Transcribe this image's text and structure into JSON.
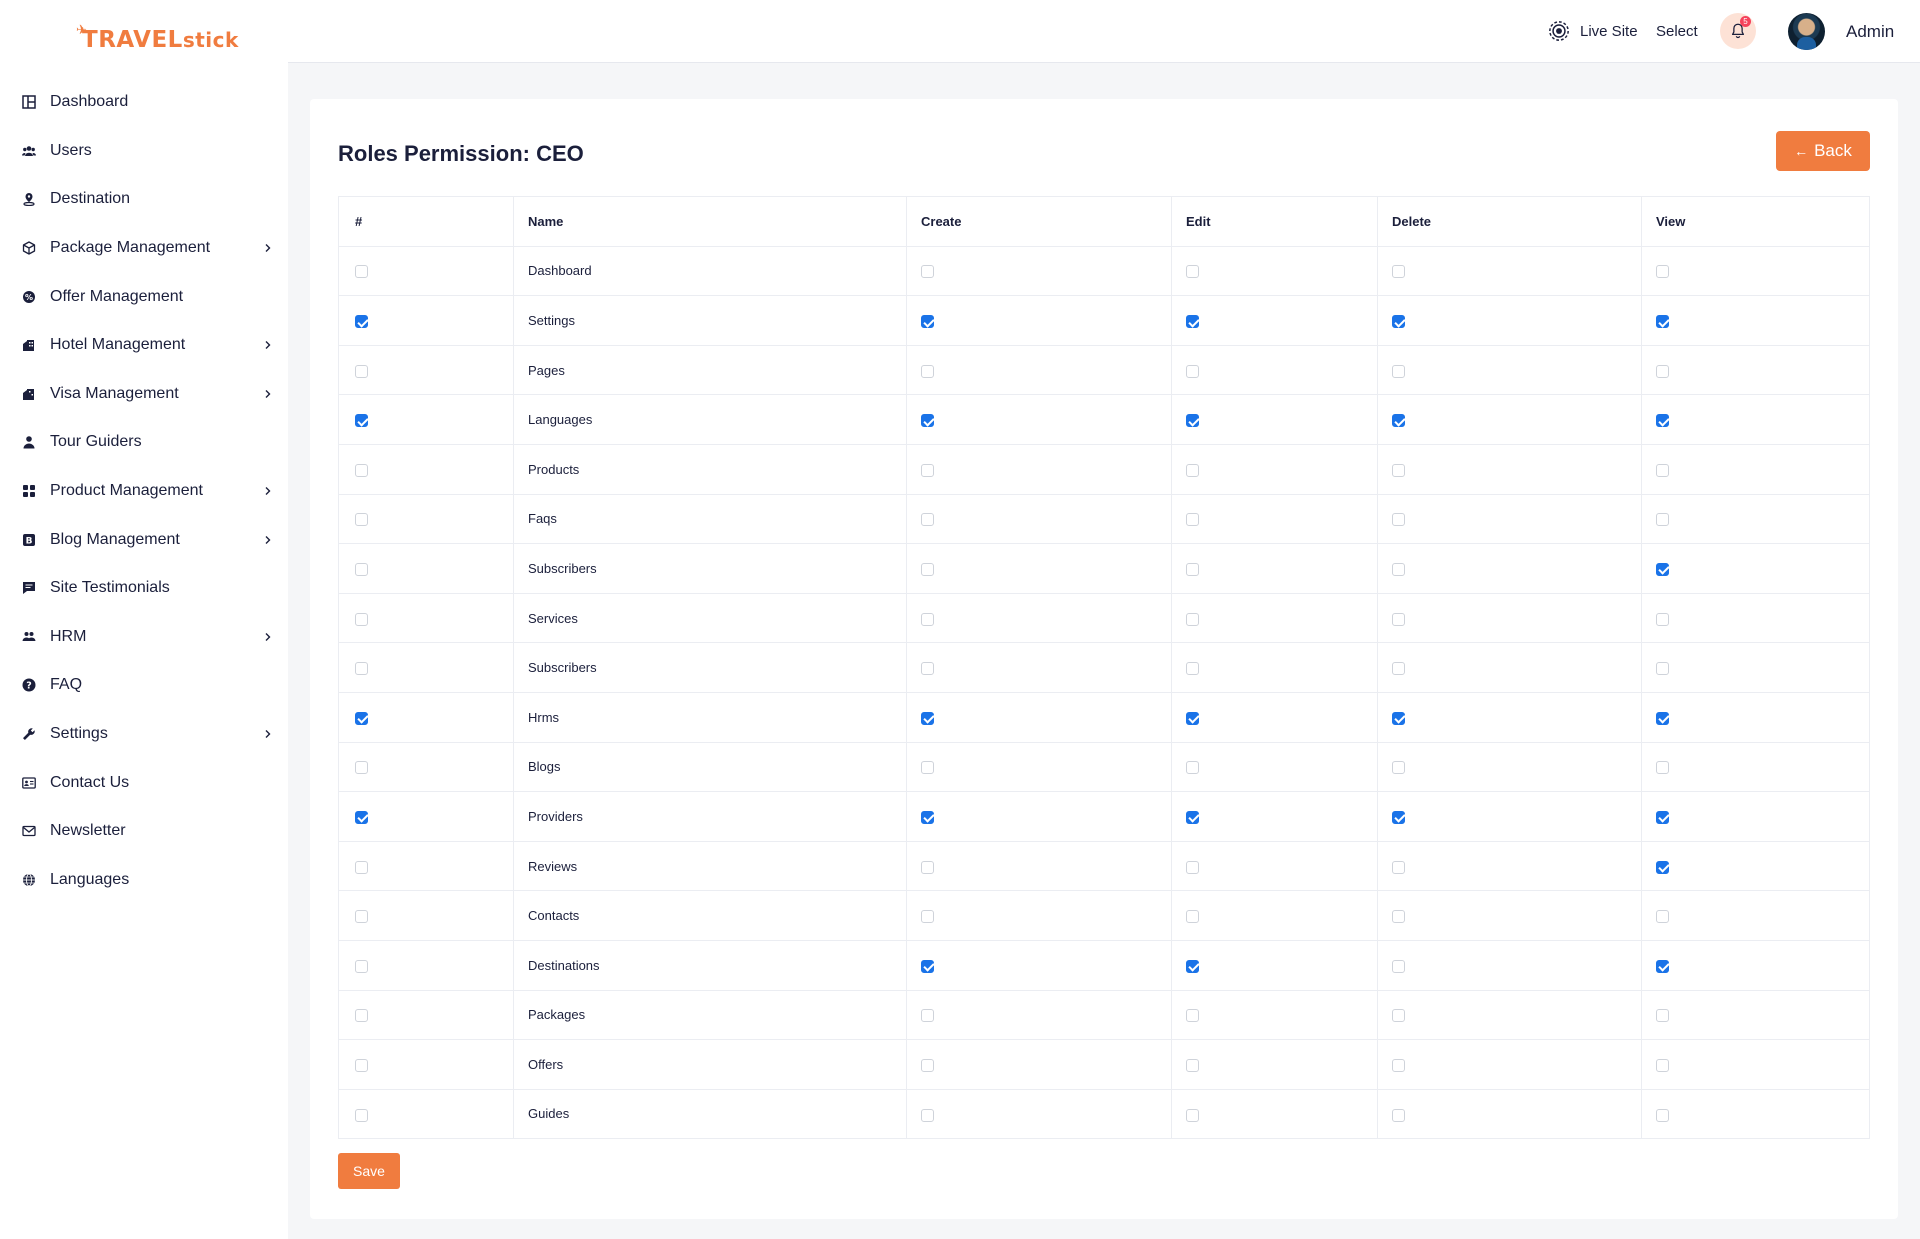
{
  "brand": {
    "logo_main": "TRAVEL",
    "logo_tail": "stick",
    "accent": "#f07c3f"
  },
  "sidebar": {
    "items": [
      {
        "label": "Dashboard",
        "icon": "dashboard-icon",
        "has_submenu": false
      },
      {
        "label": "Users",
        "icon": "users-icon",
        "has_submenu": false
      },
      {
        "label": "Destination",
        "icon": "map-pin-icon",
        "has_submenu": false
      },
      {
        "label": "Package Management",
        "icon": "box-icon",
        "has_submenu": true
      },
      {
        "label": "Offer Management",
        "icon": "offer-badge-icon",
        "has_submenu": false
      },
      {
        "label": "Hotel Management",
        "icon": "hotel-icon",
        "has_submenu": true
      },
      {
        "label": "Visa Management",
        "icon": "visa-icon",
        "has_submenu": true
      },
      {
        "label": "Tour Guiders",
        "icon": "guide-icon",
        "has_submenu": false
      },
      {
        "label": "Product Management",
        "icon": "grid-icon",
        "has_submenu": true
      },
      {
        "label": "Blog Management",
        "icon": "blog-icon",
        "has_submenu": true
      },
      {
        "label": "Site Testimonials",
        "icon": "comment-icon",
        "has_submenu": false
      },
      {
        "label": "HRM",
        "icon": "people-icon",
        "has_submenu": true
      },
      {
        "label": "FAQ",
        "icon": "question-icon",
        "has_submenu": false
      },
      {
        "label": "Settings",
        "icon": "wrench-icon",
        "has_submenu": true
      },
      {
        "label": "Contact Us",
        "icon": "contact-card-icon",
        "has_submenu": false
      },
      {
        "label": "Newsletter",
        "icon": "envelope-icon",
        "has_submenu": false
      },
      {
        "label": "Languages",
        "icon": "globe-icon",
        "has_submenu": false
      }
    ]
  },
  "topbar": {
    "live_site": "Live Site",
    "select": "Select",
    "notification_count": "5",
    "user_name": "Admin"
  },
  "page": {
    "title": "Roles Permission: CEO",
    "back_label": "Back",
    "save_label": "Save"
  },
  "table": {
    "headers": [
      "#",
      "Name",
      "Create",
      "Edit",
      "Delete",
      "View"
    ],
    "rows": [
      {
        "name": "Dashboard",
        "all": false,
        "create": false,
        "edit": false,
        "delete": false,
        "view": false
      },
      {
        "name": "Settings",
        "all": true,
        "create": true,
        "edit": true,
        "delete": true,
        "view": true
      },
      {
        "name": "Pages",
        "all": false,
        "create": false,
        "edit": false,
        "delete": false,
        "view": false
      },
      {
        "name": "Languages",
        "all": true,
        "create": true,
        "edit": true,
        "delete": true,
        "view": true
      },
      {
        "name": "Products",
        "all": false,
        "create": false,
        "edit": false,
        "delete": false,
        "view": false
      },
      {
        "name": "Faqs",
        "all": false,
        "create": false,
        "edit": false,
        "delete": false,
        "view": false
      },
      {
        "name": "Subscribers",
        "all": false,
        "create": false,
        "edit": false,
        "delete": false,
        "view": true
      },
      {
        "name": "Services",
        "all": false,
        "create": false,
        "edit": false,
        "delete": false,
        "view": false
      },
      {
        "name": "Subscribers",
        "all": false,
        "create": false,
        "edit": false,
        "delete": false,
        "view": false
      },
      {
        "name": "Hrms",
        "all": true,
        "create": true,
        "edit": true,
        "delete": true,
        "view": true
      },
      {
        "name": "Blogs",
        "all": false,
        "create": false,
        "edit": false,
        "delete": false,
        "view": false
      },
      {
        "name": "Providers",
        "all": true,
        "create": true,
        "edit": true,
        "delete": true,
        "view": true
      },
      {
        "name": "Reviews",
        "all": false,
        "create": false,
        "edit": false,
        "delete": false,
        "view": true
      },
      {
        "name": "Contacts",
        "all": false,
        "create": false,
        "edit": false,
        "delete": false,
        "view": false
      },
      {
        "name": "Destinations",
        "all": false,
        "create": true,
        "edit": true,
        "delete": false,
        "view": true
      },
      {
        "name": "Packages",
        "all": false,
        "create": false,
        "edit": false,
        "delete": false,
        "view": false
      },
      {
        "name": "Offers",
        "all": false,
        "create": false,
        "edit": false,
        "delete": false,
        "view": false
      },
      {
        "name": "Guides",
        "all": false,
        "create": false,
        "edit": false,
        "delete": false,
        "view": false
      }
    ]
  }
}
